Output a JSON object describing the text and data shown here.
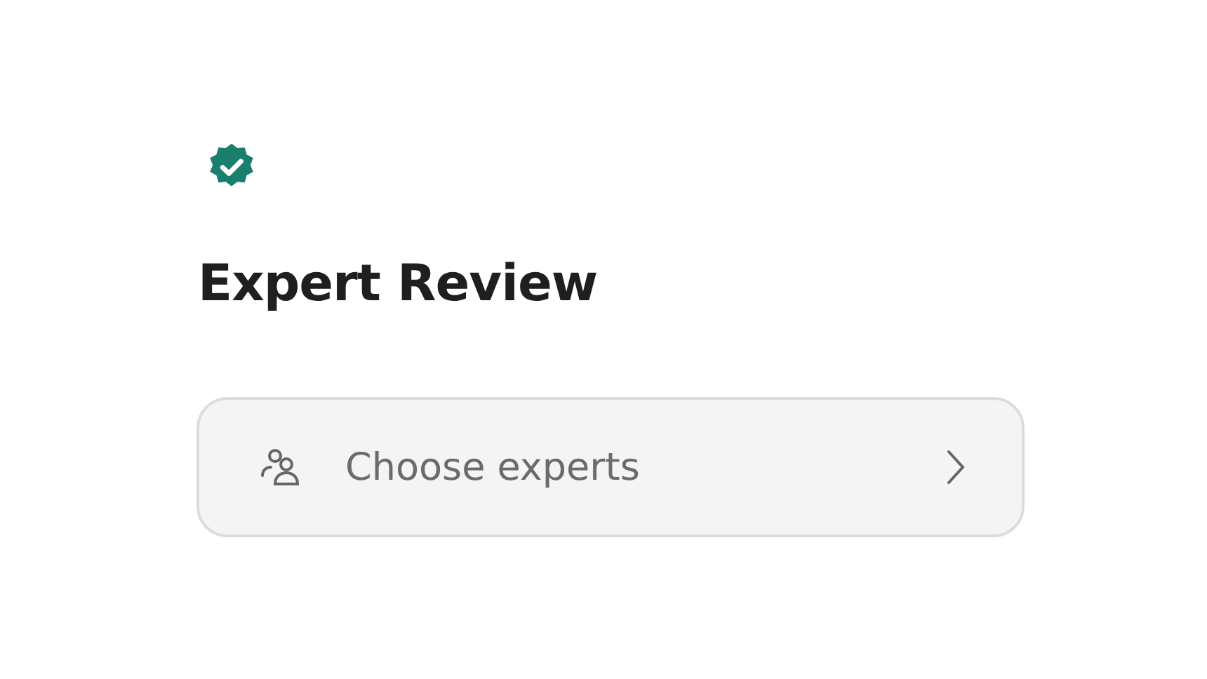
{
  "title": "Expert Review",
  "selector": {
    "label": "Choose experts"
  }
}
